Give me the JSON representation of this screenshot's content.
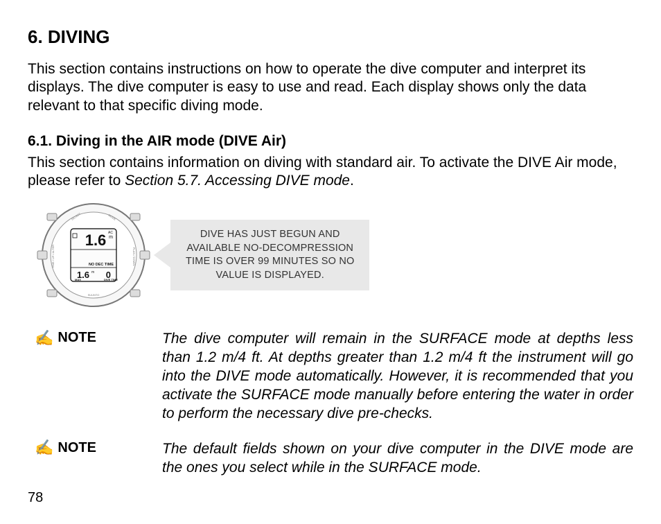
{
  "chapter": {
    "title": "6. DIVING"
  },
  "intro": "This section contains instructions on how to operate the dive computer and interpret its displays. The dive computer is easy to use and read. Each display shows only the data relevant to that specific diving mode.",
  "section61": {
    "title": "6.1. Diving in the AIR mode (DIVE Air)",
    "body_part1": "This section contains information on diving with standard air. To activate the DIVE Air mode, please refer to ",
    "body_ref": "Section 5.7. Accessing DIVE mode",
    "body_part2": "."
  },
  "watch": {
    "depth": "1.6",
    "depth_unit": "m",
    "ac_label": "AC",
    "no_dec_label": "NO DEC TIME",
    "max_depth": "1.6",
    "max_depth_unit": "m",
    "bottom_right": "0",
    "max_label": "MAX",
    "divetime_label": "DIVE TIME",
    "bezel": {
      "top_left": "SELECT",
      "top_right": "MODE",
      "mid_left": "TIME / UP / ALTER",
      "mid_right": "PLAN / DOWN",
      "down": "SUUNTO"
    }
  },
  "callout": {
    "line1": "DIVE HAS JUST BEGUN AND",
    "line2": "AVAILABLE NO-DECOMPRESSION",
    "line3": "TIME IS OVER 99 MINUTES SO NO",
    "line4": "VALUE IS DISPLAYED."
  },
  "note1": {
    "label": "NOTE",
    "body": "The dive computer will remain in the SURFACE mode at depths less than 1.2 m/4 ft. At depths greater than 1.2 m/4 ft the instru­ment will go into the DIVE mode automatically. However, it is re­commended that you activate the SURFACE mode manually before entering the water in order to perform the necessary dive pre-checks."
  },
  "note2": {
    "label": "NOTE",
    "body": "The default fields shown on your dive computer in the DIVE mode are the ones you select while in the SURFACE mode."
  },
  "page": "78",
  "icons": {
    "note_glyph": "✍"
  }
}
